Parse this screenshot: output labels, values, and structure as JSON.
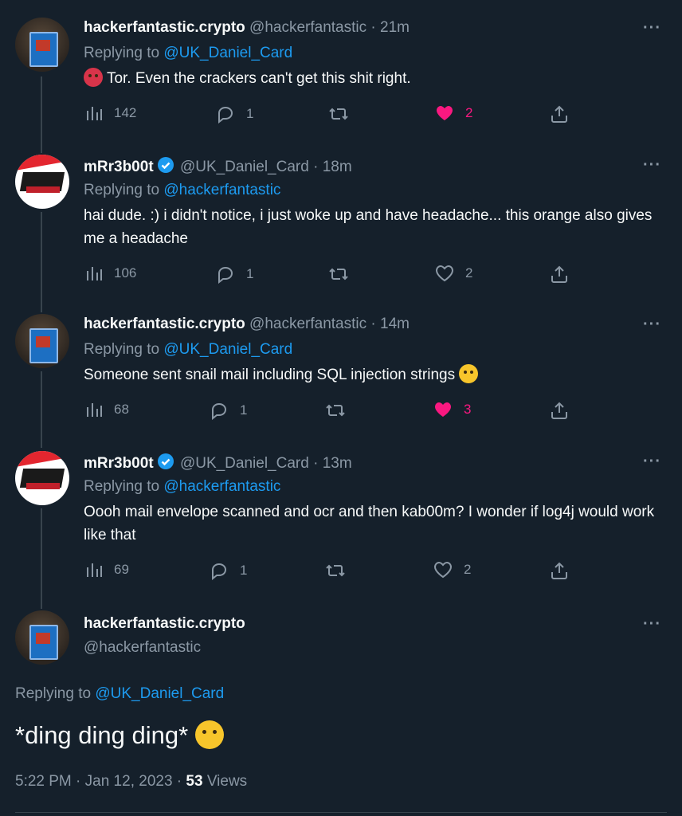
{
  "tweets": [
    {
      "name": "hackerfantastic.crypto",
      "handle": "@hackerfantastic",
      "time": "21m",
      "replying_label": "Replying to",
      "replying_to": "@UK_Daniel_Card",
      "text": "Tor. Even the crackers can't get this shit right.",
      "verified": false,
      "views": "142",
      "replies": "1",
      "likes": "2",
      "liked": true
    },
    {
      "name": "mRr3b00t",
      "handle": "@UK_Daniel_Card",
      "time": "18m",
      "replying_label": "Replying to",
      "replying_to": "@hackerfantastic",
      "text": "hai dude. :) i didn't notice, i just woke up and have headache... this orange also gives me a headache",
      "verified": true,
      "views": "106",
      "replies": "1",
      "likes": "2",
      "liked": false
    },
    {
      "name": "hackerfantastic.crypto",
      "handle": "@hackerfantastic",
      "time": "14m",
      "replying_label": "Replying to",
      "replying_to": "@UK_Daniel_Card",
      "text": "Someone sent snail mail including SQL injection strings",
      "verified": false,
      "views": "68",
      "replies": "1",
      "likes": "3",
      "liked": true
    },
    {
      "name": "mRr3b00t",
      "handle": "@UK_Daniel_Card",
      "time": "13m",
      "replying_label": "Replying to",
      "replying_to": "@hackerfantastic",
      "text": "Oooh mail envelope scanned and ocr and then kab00m? I wonder if log4j would work like that",
      "verified": true,
      "views": "69",
      "replies": "1",
      "likes": "2",
      "liked": false
    }
  ],
  "main_tweet": {
    "name": "hackerfantastic.crypto",
    "handle": "@hackerfantastic",
    "replying_label": "Replying to",
    "replying_to": "@UK_Daniel_Card",
    "text": "*ding ding ding*",
    "timestamp": "5:22 PM · Jan 12, 2023 · ",
    "views_count": "53",
    "views_label": "Views"
  },
  "separator": "·",
  "more_label": "···",
  "colors": {
    "background": "#15202b",
    "accent": "#1d9bf0",
    "like": "#f91880",
    "muted": "#8b98a5"
  },
  "icons": [
    "views-icon",
    "reply-icon",
    "retweet-icon",
    "like-icon",
    "share-icon",
    "more-icon",
    "verified-badge-icon"
  ]
}
